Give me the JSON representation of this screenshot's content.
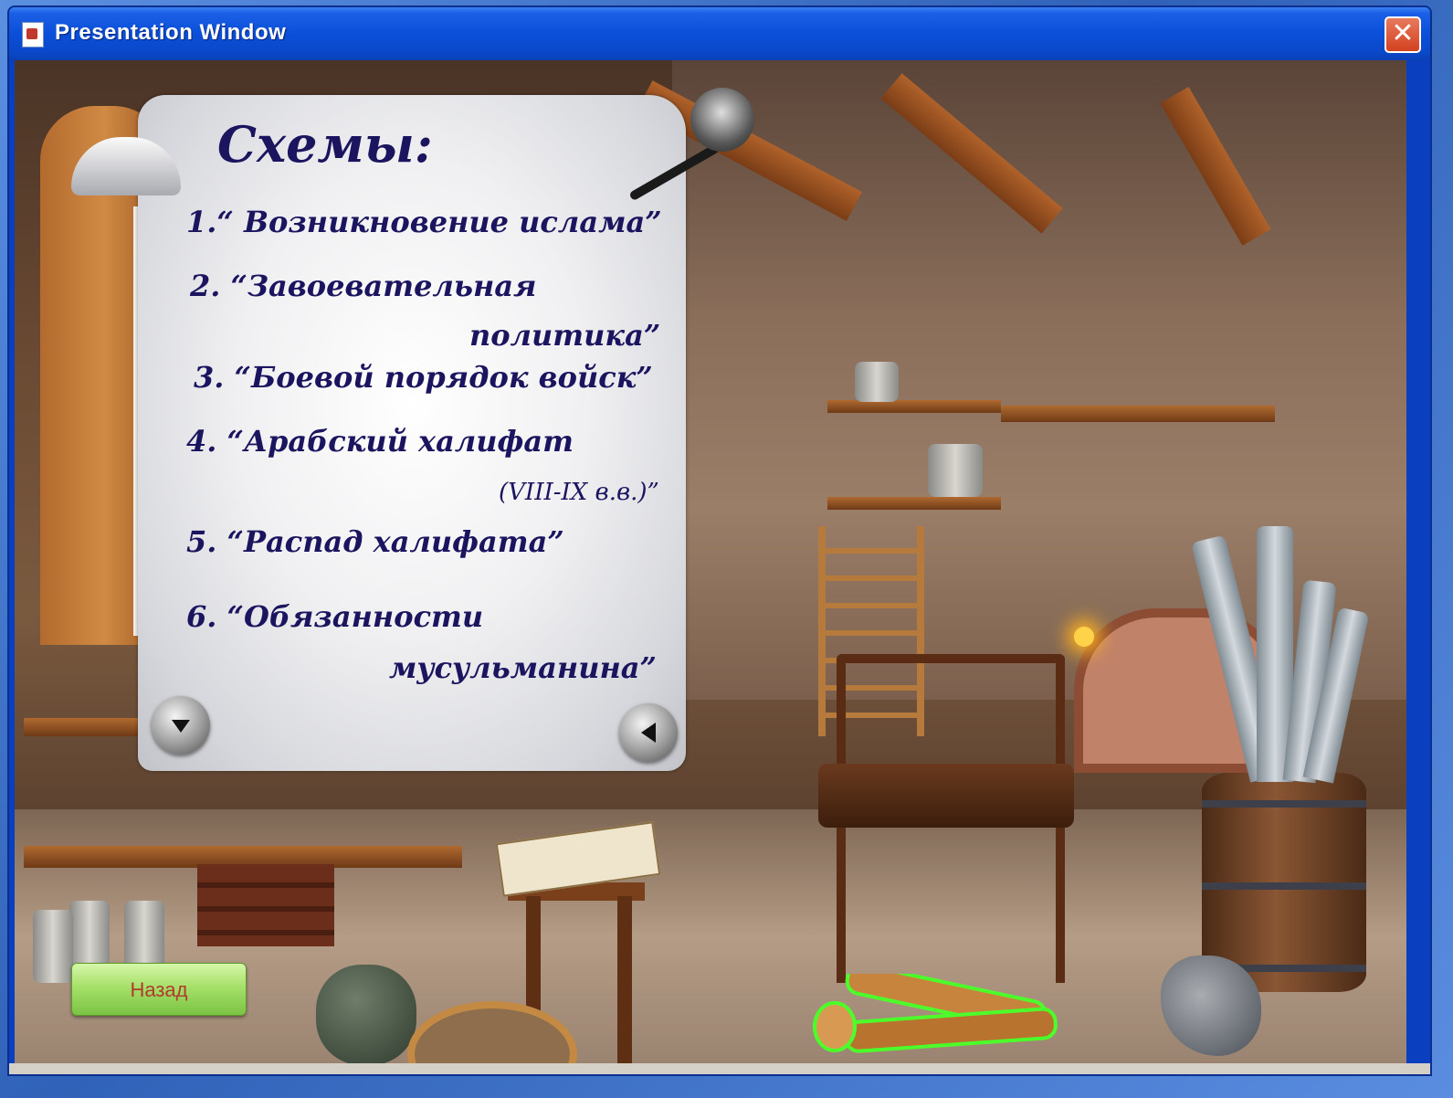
{
  "window": {
    "title": "Presentation Window",
    "close_glyph": "✕"
  },
  "scroll": {
    "heading": "Схемы:",
    "items": [
      {
        "line1": "1.“ Возникновение ислама”"
      },
      {
        "line1": "2. “Завоевательная",
        "line2": "политика”"
      },
      {
        "line1": "3. “Боевой порядок войск”"
      },
      {
        "line1": "4. “Арабский халифат",
        "line2": "(VIII-IX в.в.)”"
      },
      {
        "line1": "5. “Распад халифата”"
      },
      {
        "line1": "6. “Обязанности",
        "line2": "мусульманина”"
      }
    ]
  },
  "controls": {
    "back_label": "Назад"
  },
  "colors": {
    "text": "#1b1560",
    "back_button": "#a6e06a",
    "back_text": "#b03a2c",
    "highlight": "#4cff2a"
  },
  "icons": {
    "title_icon": "document-icon",
    "nav_down": "triangle-down-icon",
    "nav_left": "triangle-left-icon"
  }
}
